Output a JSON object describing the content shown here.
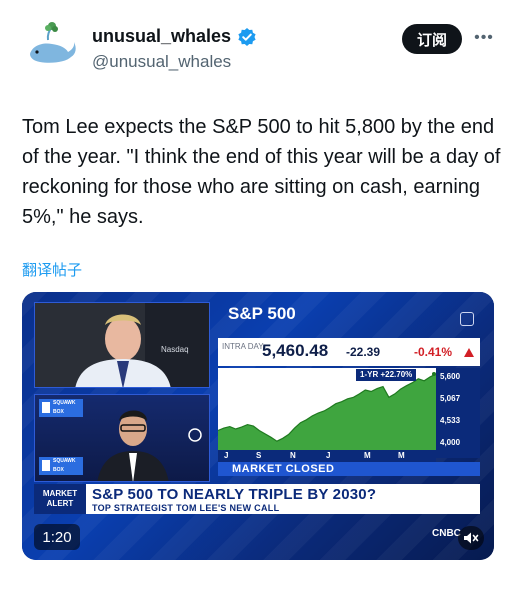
{
  "author": {
    "display_name": "unusual_whales",
    "handle": "@unusual_whales",
    "verified": true,
    "avatar_icon": "whale-avatar-icon"
  },
  "actions": {
    "subscribe_label": "订阅",
    "more_label": "•••"
  },
  "tweet": {
    "text": "Tom Lee expects the S&P 500 to hit 5,800 by the end of the year.  \"I think the end of this year will be a day of reckoning for those who are sitting on cash, earning 5%,\" he says.",
    "translate_label": "翻译帖子"
  },
  "video": {
    "duration": "1:20",
    "network_logo": "CNBC",
    "camera_label": "Nasdaq",
    "squawk_label": "SQUAWK BOX",
    "stock": {
      "title": "S&P 500",
      "intraday_label": "INTRA DAY",
      "price": "5,460.48",
      "change": "-22.39",
      "percent": "-0.41%",
      "one_year": "1-YR +22.70%",
      "market_status": "MARKET CLOSED"
    },
    "chart_data": {
      "type": "area",
      "x_labels": [
        "J",
        "S",
        "N",
        "J",
        "M",
        "M"
      ],
      "y_ticks": [
        "5,600",
        "5,067",
        "4,533",
        "4,000"
      ],
      "ylim": [
        4000,
        5600
      ],
      "series": [
        {
          "values": [
            4400,
            4450,
            4480,
            4430,
            4470,
            4520,
            4490,
            4400,
            4330,
            4260,
            4180,
            4240,
            4320,
            4450,
            4560,
            4620,
            4700,
            4760,
            4800,
            4870,
            4950,
            4990,
            5050,
            5080,
            5150,
            5230,
            5200,
            5260,
            5300,
            5080,
            5150,
            5250,
            5320,
            5380,
            5460,
            5420,
            5500,
            5560
          ]
        }
      ]
    },
    "lower_third": {
      "alert_label": "MARKET ALERT",
      "headline": "S&P 500 TO NEARLY TRIPLE BY 2030?",
      "subheadline": "TOP STRATEGIST TOM LEE'S NEW CALL"
    }
  }
}
